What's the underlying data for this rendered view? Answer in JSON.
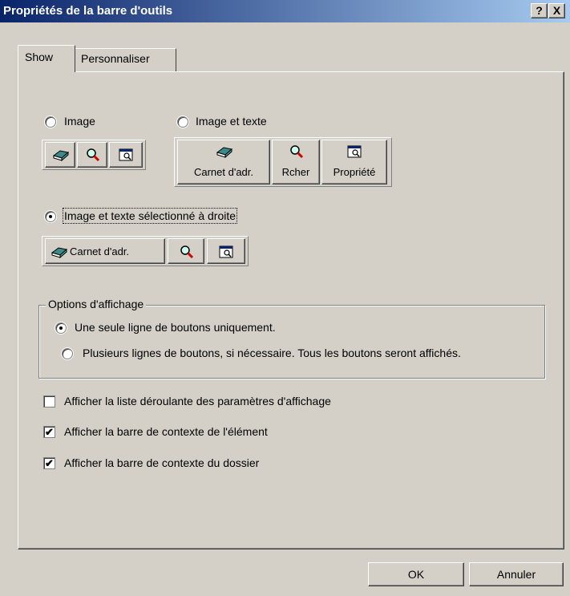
{
  "window": {
    "title": "Propriétés de la barre d'outils",
    "help_label": "?",
    "close_label": "X"
  },
  "tabs": [
    {
      "label": "Show",
      "active": true
    },
    {
      "label": "Personnaliser",
      "active": false
    }
  ],
  "style_options": {
    "image": {
      "label": "Image",
      "selected": false
    },
    "image_text": {
      "label": "Image et texte",
      "selected": false
    },
    "image_text_right": {
      "label": "Image et texte sélectionné à droite",
      "selected": true
    }
  },
  "preview": {
    "address_book_label": "Carnet d'adr.",
    "search_label": "Rcher",
    "properties_label": "Propriété"
  },
  "display_options": {
    "legend": "Options d'affichage",
    "single_row": {
      "label": "Une seule ligne de boutons uniquement.",
      "selected": true
    },
    "multi_row": {
      "label": "Plusieurs lignes de boutons, si nécessaire. Tous les boutons seront affichés.",
      "selected": false
    }
  },
  "checkboxes": [
    {
      "label": "Afficher la liste déroulante des paramètres d'affichage",
      "checked": false
    },
    {
      "label": "Afficher la barre de contexte de l'élément",
      "checked": true
    },
    {
      "label": "Afficher la barre de contexte du dossier",
      "checked": true
    }
  ],
  "footer": {
    "ok_label": "OK",
    "cancel_label": "Annuler"
  },
  "colors": {
    "titlebar_start": "#0a246a",
    "titlebar_end": "#a6caf0",
    "face": "#d4d0c8"
  },
  "icons": {
    "address_book": "address-book-icon",
    "search": "magnifier-icon",
    "properties": "properties-icon",
    "check": "✔"
  }
}
